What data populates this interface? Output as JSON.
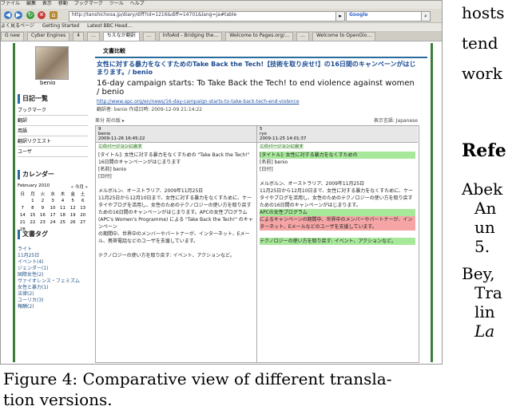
{
  "browser": {
    "menu_items": [
      "ファイル",
      "編集",
      "表示",
      "移動",
      "ブックマーク",
      "ツール",
      "ヘルプ"
    ],
    "url": "http://tanshichosa.jp/diary/diff?id=1216&diff=14701&lang=ja#table",
    "search_engine": "Google",
    "bookmarks": [
      "よく見るページ",
      "Getting Started",
      "Latest BBC Head..."
    ],
    "tabs": [
      "G new",
      "Cyber Engines",
      "4",
      "…",
      "ちえなか翻訳",
      "…",
      "InfoAid - Bridging the…",
      "Welcome to Pages.org/…",
      "…",
      "Welcome to OpenGlo…"
    ]
  },
  "sidebar": {
    "user": "benio",
    "links": [
      "日記一覧",
      "ブックマーク",
      "翻訳",
      "用語",
      "翻訳リクエスト",
      "ユーザ"
    ],
    "calendar_title": "カレンダー",
    "calendar_month": "February 2010",
    "calendar_nav": "« 今月 »",
    "weekdays": [
      "日",
      "月",
      "火",
      "水",
      "木",
      "金",
      "土"
    ],
    "weeks": [
      [
        "",
        "1",
        "2",
        "3",
        "4",
        "5",
        "6"
      ],
      [
        "7",
        "8",
        "9",
        "10",
        "11",
        "12",
        "13"
      ],
      [
        "14",
        "15",
        "16",
        "17",
        "18",
        "19",
        "20"
      ],
      [
        "21",
        "22",
        "23",
        "24",
        "25",
        "26",
        "27"
      ],
      [
        "28",
        "",
        "",
        "",
        "",
        "",
        ""
      ]
    ],
    "tags_title": "文書タグ",
    "tags": [
      "ライト",
      "11月25日",
      "イベント(4)",
      "ジェンダー(1)",
      "国際女性(2)",
      "ヴァイオレンス・フェミズム",
      "女性と暴力(1)",
      "法律(2)",
      "ユーリカ(3)",
      "報酬(2)"
    ]
  },
  "content": {
    "header": "文書比較",
    "jp_title": "女性に対する暴力をなくすためのTake Back the Tech!【技術を取り戻せ!】の16日間のキャンペーンがはじまります。/ benio",
    "en_title": "16-day campaign starts: To Take Back the Tech! to end violence against women / benio",
    "link": "http://www.apc.org/en/news/16-day-campaign-starts-to-take-back-tech-end-violence",
    "meta": "翻訳者: benio  作成日時: 2009-12-09 21:14:22",
    "bar_left": "差分   前の版 ▸",
    "bar_right": "表示言語: Japanese",
    "left_col": {
      "version": "9",
      "user": "benio",
      "date": "2009-11-26 16:45:22",
      "back": "このバージョンに戻す"
    },
    "right_col": {
      "version": "5",
      "user": "ryo",
      "date": "2009-11-25 14:01:37",
      "back": "このバージョンに戻す"
    },
    "left_body": [
      "[タイトル]: 女性に対する暴力をなくすための \"Take Back the Tech!\" 16日間のキャンペーンがはじまります",
      "[名前] benio",
      "[日付]",
      "",
      "メルボルン、オーストラリア、2009年11月25日",
      "11月25日から12月10日まで、女性に対する暴力をなくすために、ケータイやブログを活用し、女性のためのテクノロジーの使い方を取り戻すための16日間のキャンペーンがはじまります。APCの女性プログラム (APC's Women's Programme) による \"Take Back the Tech!\" のキャンペーン",
      "の期間中、世界中のメンバーやパートナーが、インターネット、Eメール、携帯電話などのユーザを支援しています。",
      "",
      "テクノロジーの使い方を取り戻す: イベント、アクションなど。"
    ],
    "right_body": [
      "[タイトル]: 女性に対する暴力をなくすための",
      "[名前] benio",
      "[日付]",
      "",
      "メルボルン、オーストラリア、2009年11月25日",
      "11月25日から12月10日まで、女性に対する暴力をなくすために、ケータイやブログを活用し、女性のためのテクノロジーの使い方を取り戻すための16日間のキャンペーンがはじまります。",
      "APCの女性プログラム",
      "によるキャンペーンの期間中、世界中のメンバーやパートナーが、インターネット、Eメールなどのユーザを支援しています。",
      "",
      "テクノロジーの使い方を取り戻す: イベント、アクションなど。"
    ]
  },
  "caption": "Figure 4: Comparative view of different transla-",
  "caption_line2": "tion versions.",
  "right_column": {
    "lines": [
      "hosts",
      "tend",
      "work",
      "Refe",
      "Abek",
      "An",
      "un",
      "5.",
      "Bey,",
      "Tra",
      "lin",
      "La"
    ]
  }
}
